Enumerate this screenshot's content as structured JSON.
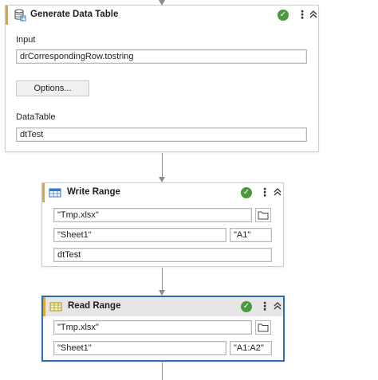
{
  "generate_data_table": {
    "title": "Generate Data Table",
    "input_label": "Input",
    "input_value": "drCorrespondingRow.tostring",
    "options_button": "Options...",
    "datatable_label": "DataTable",
    "datatable_value": "dtTest",
    "status": "✓"
  },
  "write_range": {
    "title": "Write Range",
    "workbook_path": "\"Tmp.xlsx\"",
    "sheet_name": "\"Sheet1\"",
    "starting_cell": "\"A1\"",
    "datatable": "dtTest",
    "status": "✓"
  },
  "read_range": {
    "title": "Read Range",
    "workbook_path": "\"Tmp.xlsx\"",
    "sheet_name": "\"Sheet1\"",
    "range": "\"A1:A2\"",
    "status": "✓"
  },
  "colors": {
    "accent": "#e0a43a",
    "selection": "#2a6fb5",
    "success": "#4a9a3d"
  },
  "icons": [
    "database-icon",
    "write-range-icon",
    "read-range-icon",
    "check-icon",
    "more-options-icon",
    "collapse-icon",
    "folder-icon"
  ]
}
